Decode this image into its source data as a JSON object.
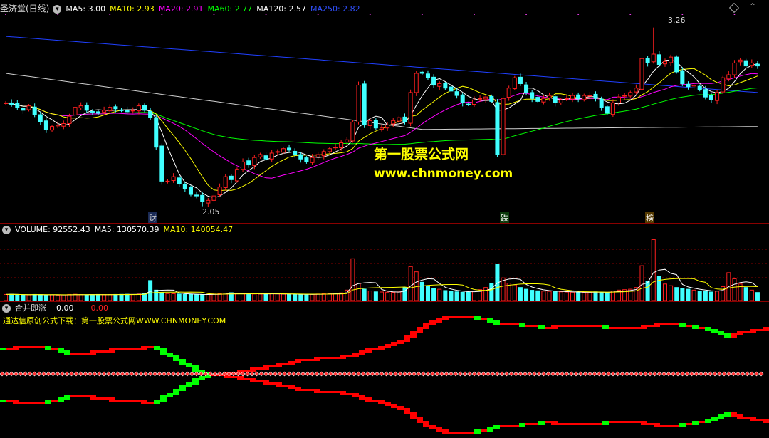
{
  "colors": {
    "bg": "#000000",
    "up": "#ff2020",
    "down": "#40ffff",
    "ma5": "#ffffff",
    "ma10": "#ffff00",
    "ma20": "#ff00ff",
    "ma60": "#00ff00",
    "ma120": "#cfcfcf",
    "ma250": "#2040ff",
    "grid": "#8a0000",
    "ind_up": "#ff0000",
    "ind_down": "#00ff00"
  },
  "price_panel": {
    "title": "圣济堂(日线)",
    "legend": [
      {
        "label": "MA5: 3.00",
        "color": "#ffffff"
      },
      {
        "label": "MA10: 2.93",
        "color": "#ffff00"
      },
      {
        "label": "MA20: 2.91",
        "color": "#ff00ff"
      },
      {
        "label": "MA60: 2.77",
        "color": "#00ff00"
      },
      {
        "label": "MA120: 2.57",
        "color": "#ffffff"
      },
      {
        "label": "MA250: 2.82",
        "color": "#2040ff"
      }
    ],
    "high_label": "3.26",
    "low_label": "2.05",
    "markers": [
      "财",
      "跌",
      "榜"
    ]
  },
  "volume_panel": {
    "legend": [
      {
        "label": "VOLUME: 92552.43",
        "color": "#ffffff"
      },
      {
        "label": "MA5: 130570.39",
        "color": "#ffffff"
      },
      {
        "label": "MA10: 140054.47",
        "color": "#ffff00"
      }
    ]
  },
  "indicator_panel": {
    "name": "合并即涨",
    "v1": "0.00",
    "v2": "0.00",
    "subtitle": "通达信原创公式下载：第一股票公式网WWW.CHNMONEY.COM"
  },
  "watermark": {
    "line1": "第一股票公式网",
    "line2": "www.chnmoney.com"
  },
  "chart_data": [
    {
      "type": "candlestick",
      "title": "圣济堂(日线)",
      "ylim": [
        2.0,
        3.35
      ],
      "annotations": [
        {
          "label": "3.26",
          "value": 3.26
        },
        {
          "label": "2.05",
          "value": 2.05
        }
      ],
      "close": [
        2.75,
        2.74,
        2.72,
        2.7,
        2.73,
        2.67,
        2.62,
        2.57,
        2.59,
        2.6,
        2.61,
        2.66,
        2.72,
        2.73,
        2.7,
        2.69,
        2.68,
        2.7,
        2.72,
        2.71,
        2.7,
        2.69,
        2.7,
        2.73,
        2.7,
        2.65,
        2.45,
        2.22,
        2.22,
        2.25,
        2.2,
        2.17,
        2.13,
        2.12,
        2.08,
        2.09,
        2.12,
        2.18,
        2.25,
        2.23,
        2.3,
        2.35,
        2.33,
        2.38,
        2.4,
        2.37,
        2.41,
        2.42,
        2.44,
        2.43,
        2.4,
        2.37,
        2.35,
        2.38,
        2.4,
        2.42,
        2.44,
        2.45,
        2.48,
        2.5,
        2.62,
        2.87,
        2.6,
        2.63,
        2.58,
        2.58,
        2.6,
        2.63,
        2.65,
        2.62,
        2.82,
        2.95,
        2.95,
        2.92,
        2.87,
        2.88,
        2.85,
        2.83,
        2.8,
        2.75,
        2.74,
        2.77,
        2.78,
        2.79,
        2.76,
        2.4,
        2.78,
        2.85,
        2.92,
        2.88,
        2.82,
        2.78,
        2.76,
        2.78,
        2.8,
        2.75,
        2.77,
        2.78,
        2.8,
        2.78,
        2.8,
        2.8,
        2.78,
        2.72,
        2.68,
        2.75,
        2.79,
        2.8,
        2.82,
        2.85,
        3.05,
        3.02,
        3.08,
        3.01,
        3.03,
        3.06,
        2.96,
        2.88,
        2.86,
        2.87,
        2.84,
        2.79,
        2.77,
        2.82,
        2.92,
        2.94,
        3.02,
        3.04,
        3.0,
        3.02,
        3.0
      ],
      "volume": [
        70000,
        72000,
        68000,
        66000,
        65000,
        70000,
        68000,
        64000,
        66000,
        62000,
        65000,
        70000,
        72000,
        68000,
        66000,
        67000,
        70000,
        68000,
        69000,
        70000,
        71000,
        72000,
        70000,
        75000,
        80000,
        230000,
        120000,
        90000,
        80000,
        78000,
        75000,
        70000,
        72000,
        68000,
        66000,
        70000,
        75000,
        80000,
        85000,
        90000,
        80000,
        78000,
        76000,
        75000,
        74000,
        78000,
        80000,
        76000,
        74000,
        72000,
        70000,
        68000,
        70000,
        72000,
        75000,
        78000,
        80000,
        84000,
        88000,
        120000,
        480000,
        200000,
        130000,
        110000,
        100000,
        98000,
        96000,
        94000,
        100000,
        150000,
        390000,
        330000,
        210000,
        170000,
        140000,
        130000,
        115000,
        105000,
        100000,
        95000,
        96000,
        110000,
        125000,
        150000,
        200000,
        420000,
        260000,
        200000,
        180000,
        150000,
        130000,
        118000,
        112000,
        108000,
        105000,
        102000,
        100000,
        98000,
        96000,
        94000,
        92000,
        96000,
        100000,
        95000,
        90000,
        110000,
        120000,
        125000,
        130000,
        150000,
        400000,
        220000,
        700000,
        280000,
        190000,
        170000,
        150000,
        140000,
        130000,
        120000,
        110000,
        105000,
        98000,
        110000,
        160000,
        320000,
        250000,
        190000,
        150000,
        120000,
        92552
      ],
      "indicator": {
        "v1": 0.0,
        "v2": 0.0
      }
    }
  ]
}
